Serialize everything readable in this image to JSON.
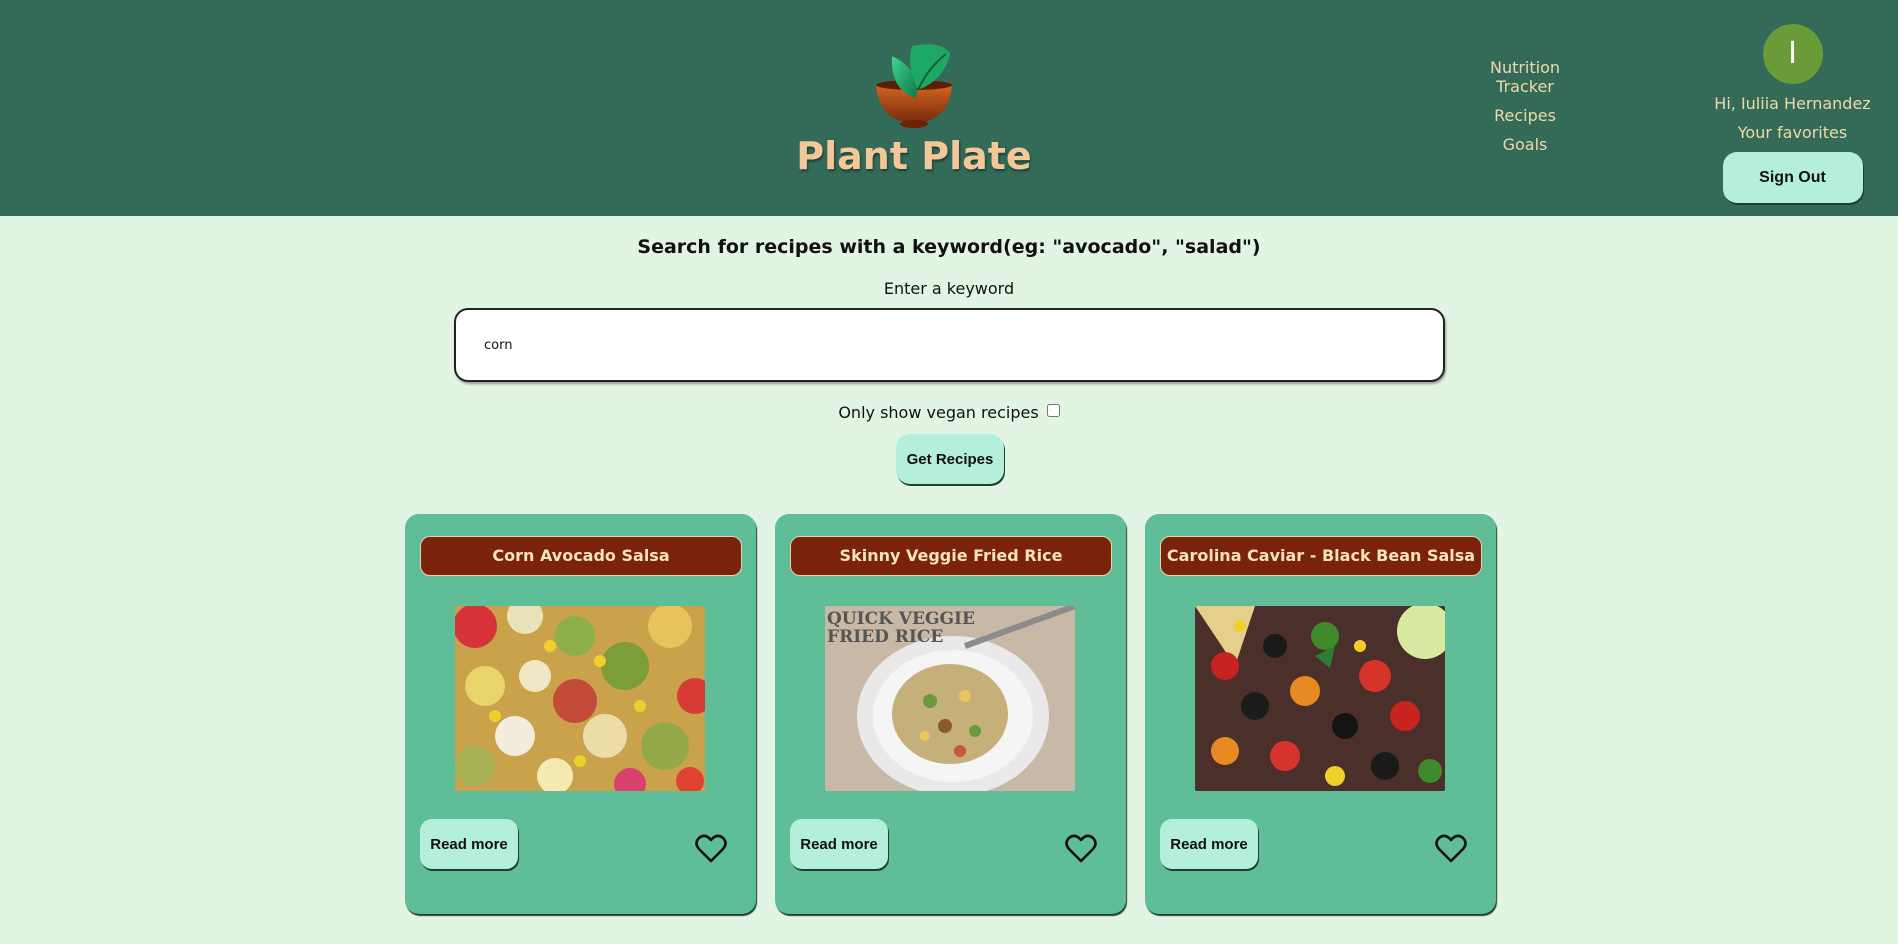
{
  "header": {
    "brand": "Plant Plate",
    "nav": [
      {
        "label": "Nutrition Tracker"
      },
      {
        "label": "Recipes"
      },
      {
        "label": "Goals"
      }
    ],
    "user": {
      "avatar_initial": "I",
      "greeting": "Hi, Iuliia Hernandez",
      "favorites_link": "Your favorites",
      "signout_label": "Sign Out"
    }
  },
  "search": {
    "title": "Search for recipes with a keyword(eg: \"avocado\", \"salad\")",
    "label": "Enter a keyword",
    "value": "corn",
    "vegan_label": "Only show vegan recipes",
    "vegan_checked": false,
    "button_label": "Get Recipes"
  },
  "recipes": [
    {
      "title": "Corn Avocado Salsa",
      "read_more": "Read more",
      "favorite_icon": "heart-outline-icon"
    },
    {
      "title": "Skinny Veggie Fried Rice",
      "read_more": "Read more",
      "favorite_icon": "heart-outline-icon",
      "image_text": "QUICK VEGGIE FRIED RICE"
    },
    {
      "title": "Carolina Caviar - Black Bean Salsa",
      "read_more": "Read more",
      "favorite_icon": "heart-outline-icon"
    }
  ],
  "colors": {
    "header_bg": "#336b58",
    "page_bg": "#e2f5e3",
    "brand_text": "#f3c79a",
    "nav_text": "#f0d9a8",
    "button_bg": "#b3efdb",
    "card_bg": "#5fbe98",
    "card_title_bg": "#7b220a",
    "avatar_bg": "#6a9b38"
  }
}
